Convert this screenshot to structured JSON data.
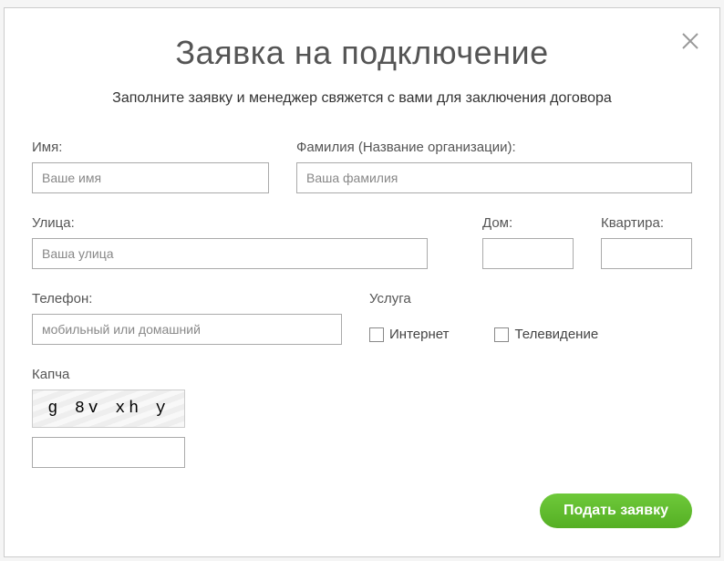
{
  "modal": {
    "title": "Заявка на подключение",
    "subtitle": "Заполните заявку и менеджер свяжется с вами для заключения договора"
  },
  "fields": {
    "name": {
      "label": "Имя:",
      "placeholder": "Ваше имя",
      "value": ""
    },
    "surname": {
      "label": "Фамилия (Название организации):",
      "placeholder": "Ваша фамилия",
      "value": ""
    },
    "street": {
      "label": "Улица:",
      "placeholder": "Ваша улица",
      "value": ""
    },
    "house": {
      "label": "Дом:",
      "placeholder": "",
      "value": ""
    },
    "apt": {
      "label": "Квартира:",
      "placeholder": "",
      "value": ""
    },
    "phone": {
      "label": "Телефон:",
      "placeholder": "мобильный или домашний",
      "value": ""
    }
  },
  "service": {
    "label": "Услуга",
    "internet": "Интернет",
    "tv": "Телевидение"
  },
  "captcha": {
    "label": "Капча",
    "text": "g 8v xh y"
  },
  "submit": {
    "label": "Подать заявку"
  }
}
